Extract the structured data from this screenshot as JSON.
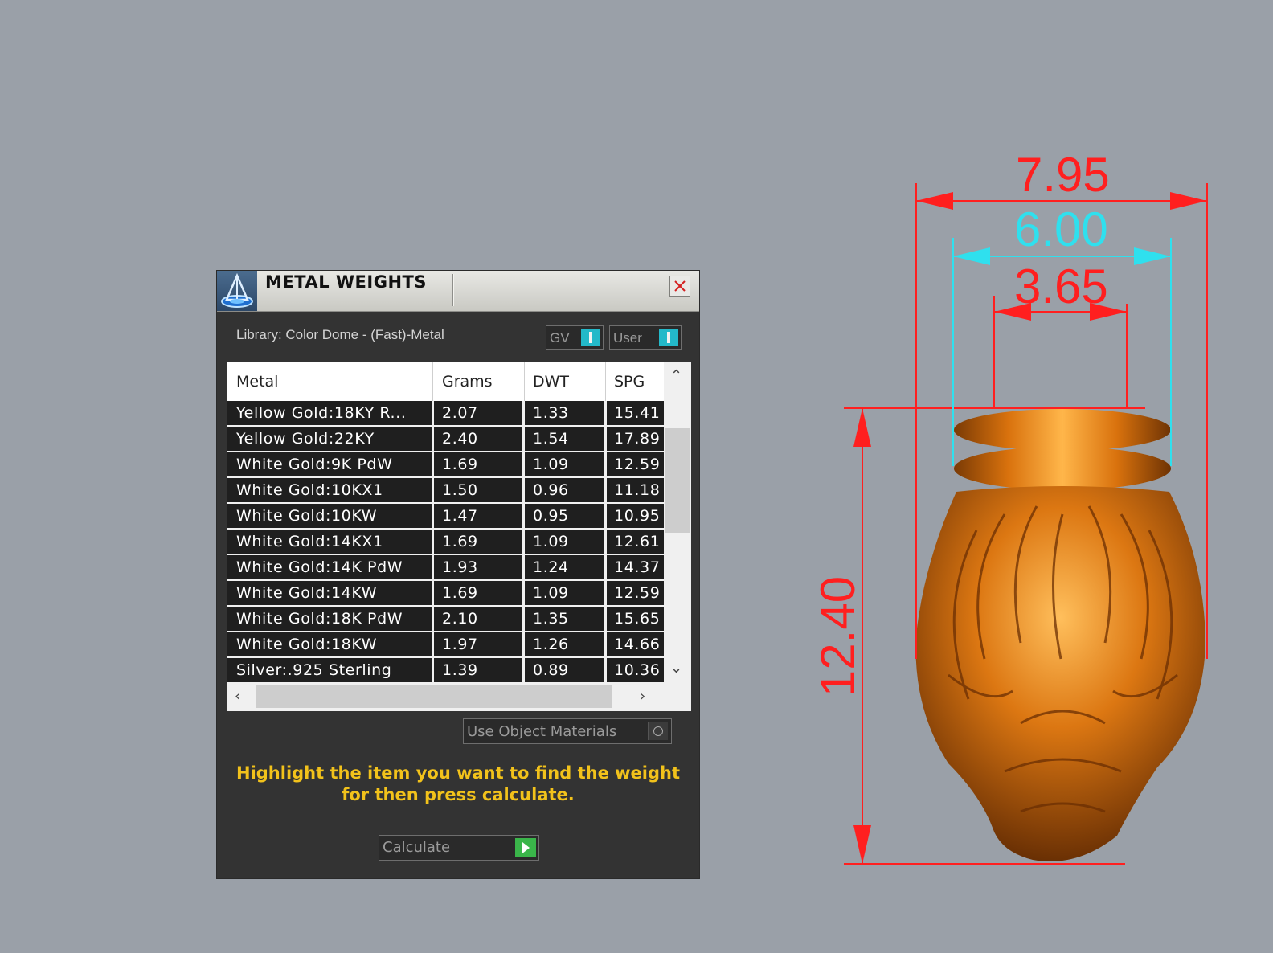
{
  "dialog": {
    "title": "METAL WEIGHTS",
    "library_label": "Library: Color Dome - (Fast)-Metal",
    "toggles": [
      {
        "label": "GV"
      },
      {
        "label": "User"
      }
    ],
    "table": {
      "columns": [
        "Metal",
        "Grams",
        "DWT",
        "SPG"
      ],
      "rows": [
        [
          "Yellow Gold:18KY R...",
          "2.07",
          "1.33",
          "15.41"
        ],
        [
          "Yellow Gold:22KY",
          "2.40",
          "1.54",
          "17.89"
        ],
        [
          "White Gold:9K PdW",
          "1.69",
          "1.09",
          "12.59"
        ],
        [
          "White Gold:10KX1",
          "1.50",
          "0.96",
          "11.18"
        ],
        [
          "White Gold:10KW",
          "1.47",
          "0.95",
          "10.95"
        ],
        [
          "White Gold:14KX1",
          "1.69",
          "1.09",
          "12.61"
        ],
        [
          "White Gold:14K PdW",
          "1.93",
          "1.24",
          "14.37"
        ],
        [
          "White Gold:14KW",
          "1.69",
          "1.09",
          "12.59"
        ],
        [
          "White Gold:18K PdW",
          "2.10",
          "1.35",
          "15.65"
        ],
        [
          "White Gold:18KW",
          "1.97",
          "1.26",
          "14.66"
        ],
        [
          "Silver:.925 Sterling",
          "1.39",
          "0.89",
          "10.36"
        ]
      ]
    },
    "use_object_materials_label": "Use Object Materials",
    "hint_line1": "Highlight the item you want to find the weight",
    "hint_line2": "for then press calculate.",
    "calculate_label": "Calculate"
  },
  "dimensions": {
    "outer_width": "7.95",
    "inner_width": "6.00",
    "top_width": "3.65",
    "height": "12.40"
  },
  "colors": {
    "viewport_bg": "#9aa0a8",
    "dim_red": "#ff1f1f",
    "dim_cyan": "#2fe0ee",
    "model_orange": "#d9720d",
    "hint_yellow": "#f2c21b"
  }
}
